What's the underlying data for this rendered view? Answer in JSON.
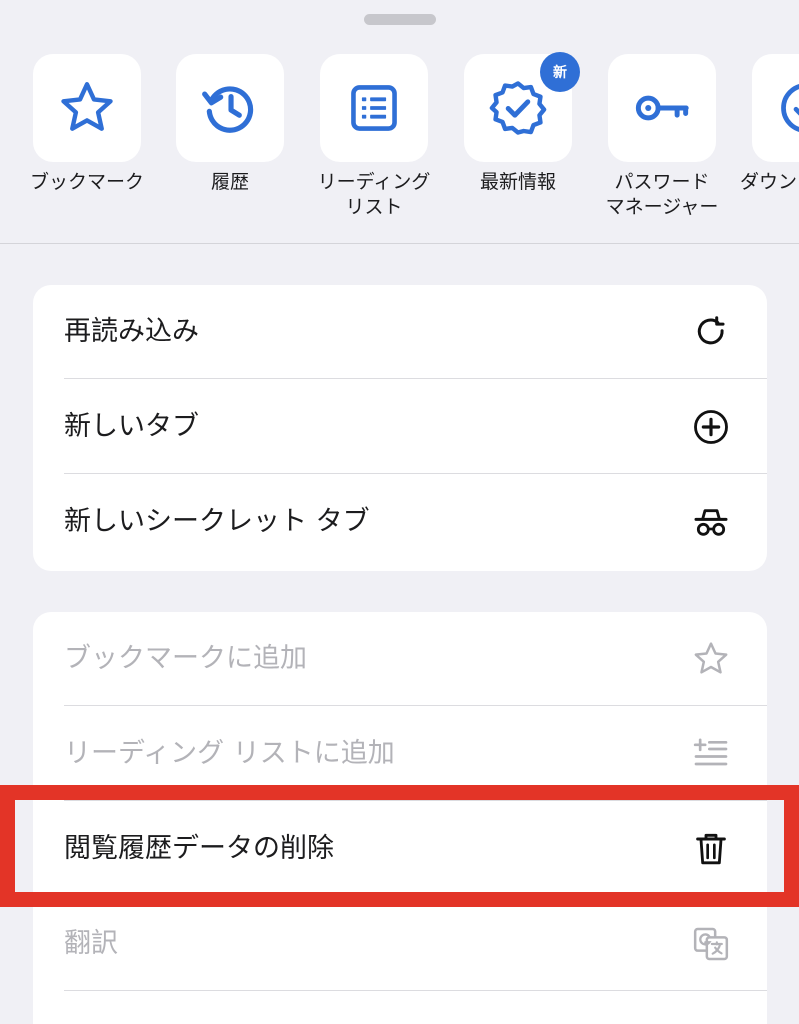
{
  "shortcuts": [
    {
      "label": "ブックマーク",
      "icon": "star-icon"
    },
    {
      "label": "履歴",
      "icon": "history-icon"
    },
    {
      "label": "リーディング\nリスト",
      "icon": "reading-list-icon"
    },
    {
      "label": "最新情報",
      "icon": "verified-badge-icon",
      "badge": "新"
    },
    {
      "label": "パスワード\nマネージャー",
      "icon": "key-icon"
    },
    {
      "label": "ダウン",
      "icon": "download-icon"
    }
  ],
  "menu_primary": [
    {
      "label": "再読み込み",
      "icon": "reload-icon"
    },
    {
      "label": "新しいタブ",
      "icon": "new-tab-plus-icon"
    },
    {
      "label": "新しいシークレット タブ",
      "icon": "incognito-icon"
    }
  ],
  "menu_secondary": [
    {
      "label": "ブックマークに追加",
      "icon": "star-outline-icon",
      "enabled": false
    },
    {
      "label": "リーディング リストに追加",
      "icon": "add-to-reading-list-icon",
      "enabled": false
    },
    {
      "label": "閲覧履歴データの削除",
      "icon": "trash-icon",
      "enabled": true
    },
    {
      "label": "翻訳",
      "icon": "translate-icon",
      "enabled": false
    }
  ],
  "colors": {
    "accent": "#2f6fd6",
    "highlight": "#e33427",
    "disabled_text": "#b3b3b8",
    "background": "#f0f0f5"
  }
}
